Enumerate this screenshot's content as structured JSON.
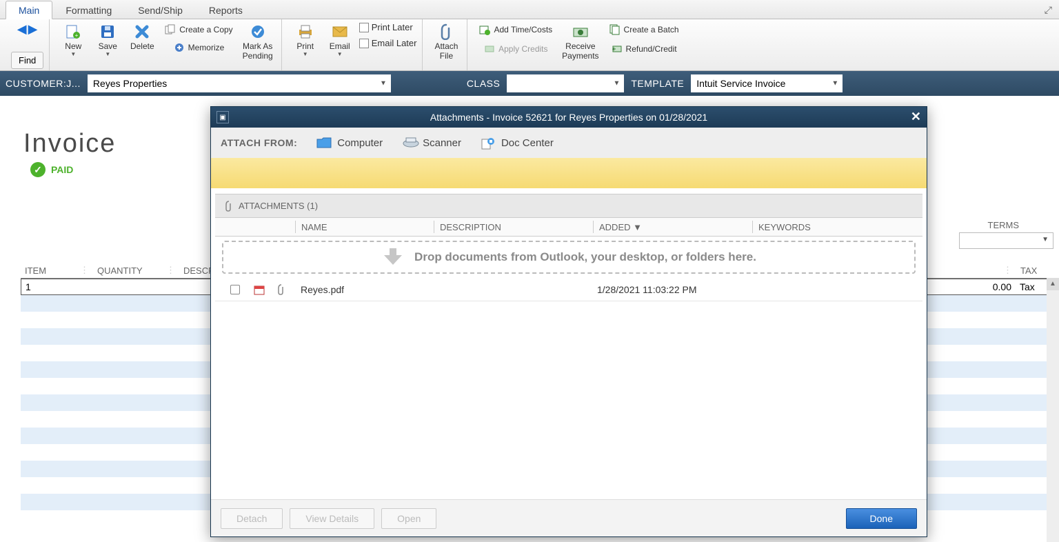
{
  "tabs": {
    "main": "Main",
    "formatting": "Formatting",
    "sendShip": "Send/Ship",
    "reports": "Reports"
  },
  "ribbon": {
    "find": "Find",
    "new": "New",
    "save": "Save",
    "delete": "Delete",
    "createCopy": "Create a Copy",
    "memorize": "Memorize",
    "markPending": "Mark As\nPending",
    "print": "Print",
    "email": "Email",
    "printLater": "Print Later",
    "emailLater": "Email Later",
    "attachFile": "Attach\nFile",
    "addTime": "Add Time/Costs",
    "applyCredits": "Apply Credits",
    "receivePayments": "Receive\nPayments",
    "createBatch": "Create a Batch",
    "refundCredit": "Refund/Credit"
  },
  "bluebar": {
    "customerLbl": "CUSTOMER:J...",
    "customerVal": "Reyes Properties",
    "classLbl": "CLASS",
    "classVal": "",
    "templateLbl": "TEMPLATE",
    "templateVal": "Intuit Service Invoice"
  },
  "invoice": {
    "title": "Invoice",
    "paid": "PAID",
    "termsLbl": "TERMS",
    "cols": {
      "item": "ITEM",
      "qty": "QUANTITY",
      "desc": "DESCRIPTI...",
      "tax": "TAX"
    },
    "row1": {
      "item": "1",
      "amt": "0.00",
      "tax": "Tax"
    }
  },
  "modal": {
    "title": "Attachments - Invoice 52621 for Reyes Properties on 01/28/2021",
    "attachFromLbl": "ATTACH FROM:",
    "computer": "Computer",
    "scanner": "Scanner",
    "docCenter": "Doc Center",
    "sectionHdr": "ATTACHMENTS (1)",
    "cols": {
      "name": "NAME",
      "desc": "DESCRIPTION",
      "added": "ADDED ▼",
      "keywords": "KEYWORDS"
    },
    "dropHint": "Drop documents from Outlook, your desktop, or folders here.",
    "file": {
      "name": "Reyes.pdf",
      "added": "1/28/2021 11:03:22 PM"
    },
    "btnDetach": "Detach",
    "btnView": "View Details",
    "btnOpen": "Open",
    "btnDone": "Done"
  }
}
